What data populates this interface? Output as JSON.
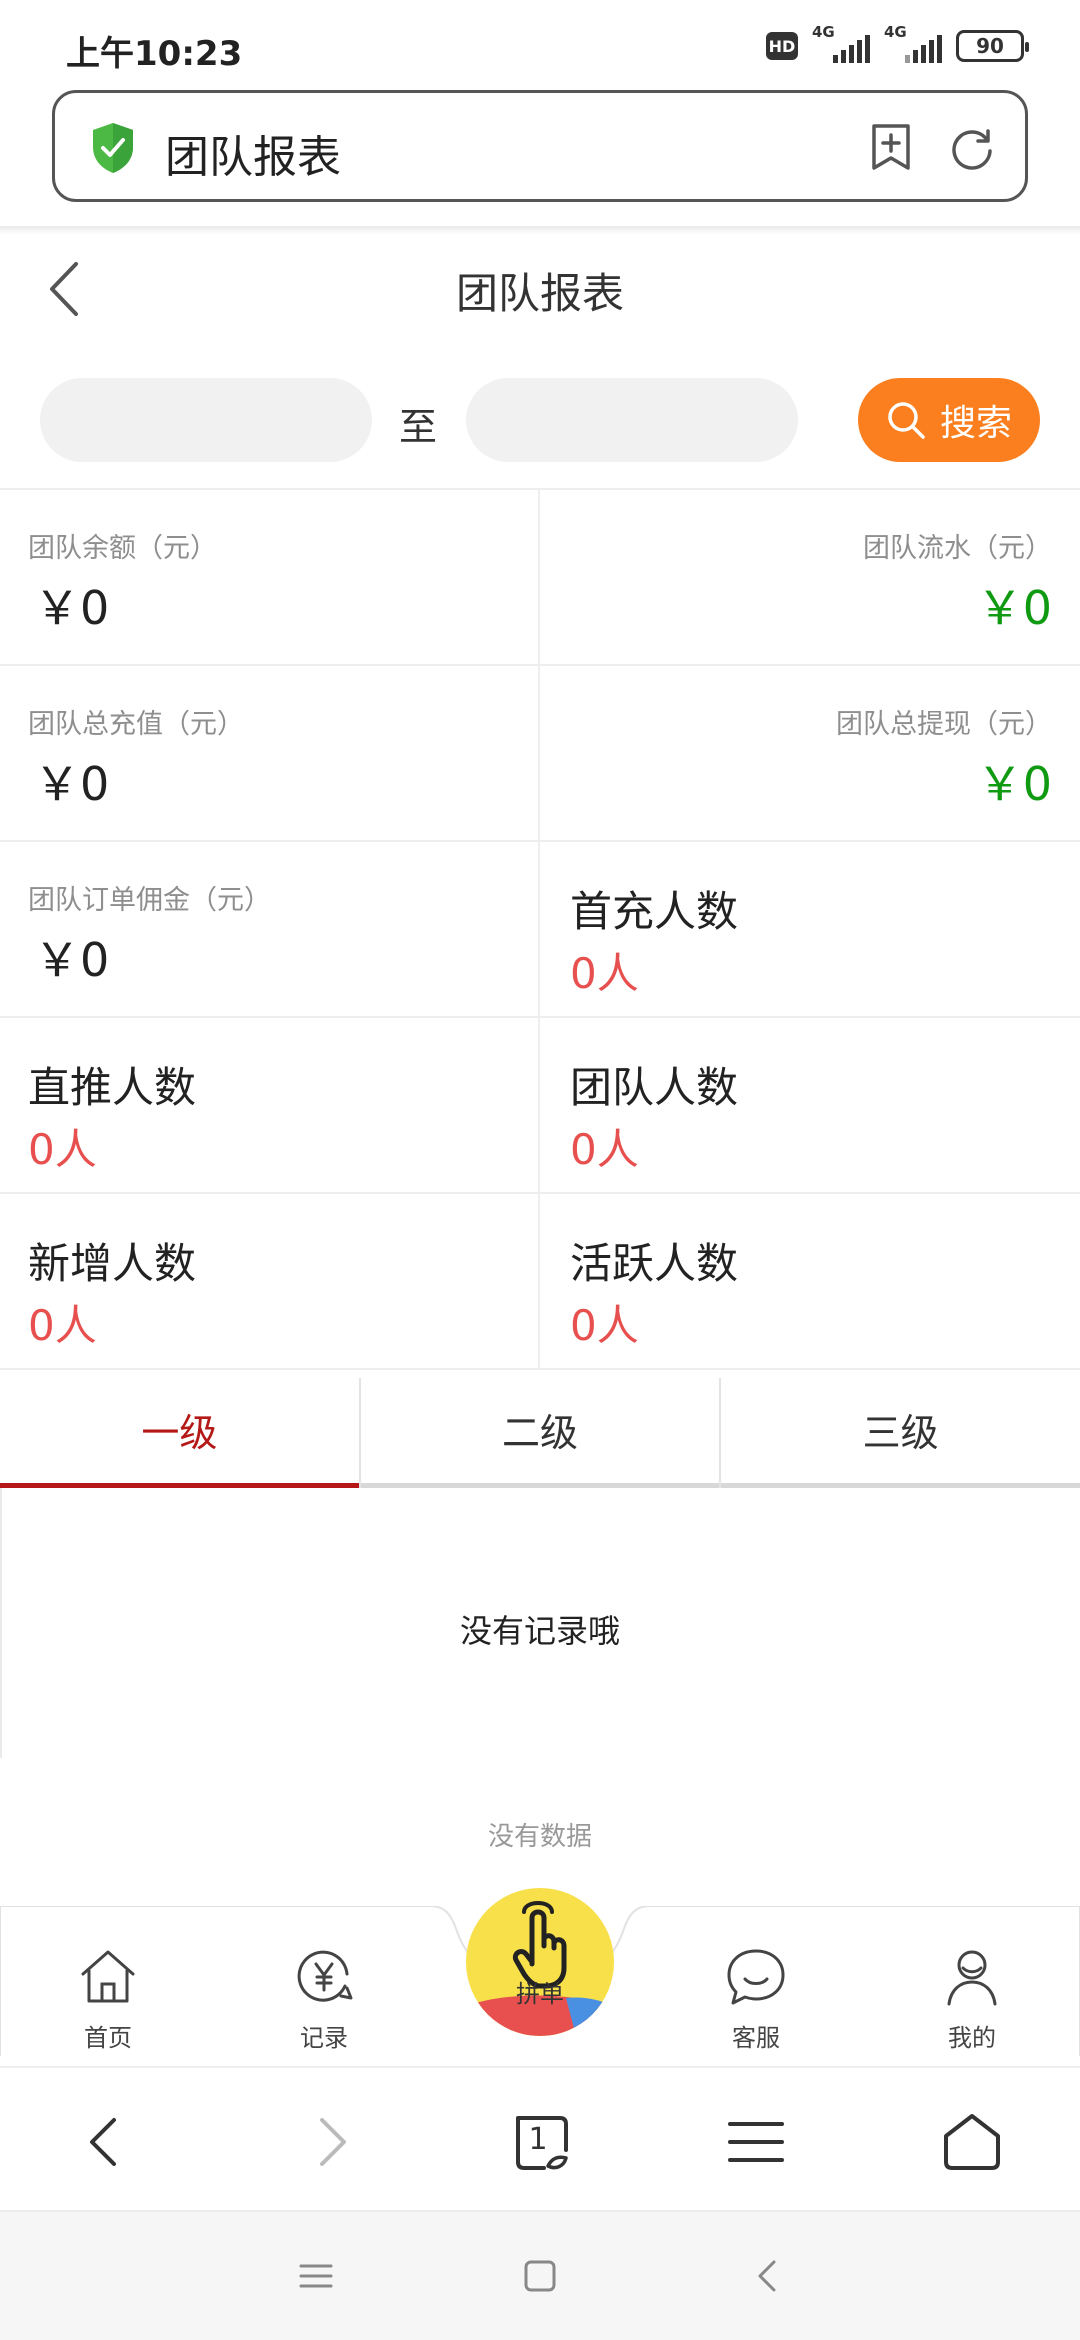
{
  "status_bar": {
    "time": "上午10:23",
    "hd_label": "HD",
    "network_1": "4G",
    "network_2": "4G",
    "battery": "90"
  },
  "address_bar": {
    "title": "团队报表",
    "icons": [
      "shield-check-icon",
      "bookmark-add-icon",
      "refresh-icon"
    ]
  },
  "header": {
    "title": "团队报表"
  },
  "search": {
    "start_date": "",
    "end_date": "",
    "separator": "至",
    "button_label": "搜索",
    "accent_color": "#fb7f1f"
  },
  "stats": {
    "balance": {
      "label": "团队余额（元）",
      "value": "￥0"
    },
    "turnover": {
      "label": "团队流水（元）",
      "value": "￥0"
    },
    "total_recharge": {
      "label": "团队总充值（元）",
      "value": "￥0"
    },
    "total_withdraw": {
      "label": "团队总提现（元）",
      "value": "￥0"
    },
    "order_commission": {
      "label": "团队订单佣金（元）",
      "value": "￥0"
    },
    "first_recharge": {
      "label": "首充人数",
      "value": "0人"
    },
    "direct_referrals": {
      "label": "直推人数",
      "value": "0人"
    },
    "team_members": {
      "label": "团队人数",
      "value": "0人"
    },
    "new_members": {
      "label": "新增人数",
      "value": "0人"
    },
    "active_members": {
      "label": "活跃人数",
      "value": "0人"
    },
    "colors": {
      "positive": "#0f9a12",
      "count": "#e8504f"
    }
  },
  "level_tabs": {
    "items": [
      {
        "label": "一级",
        "active": true
      },
      {
        "label": "二级",
        "active": false
      },
      {
        "label": "三级",
        "active": false
      }
    ],
    "active_color": "#b41817"
  },
  "list": {
    "empty_text": "没有记录哦",
    "no_data_text": "没有数据"
  },
  "bottom_nav": {
    "items": [
      {
        "label": "首页",
        "icon": "home-icon"
      },
      {
        "label": "记录",
        "icon": "yuan-record-icon"
      },
      {
        "label": "拼单",
        "icon": "tap-hand-icon"
      },
      {
        "label": "客服",
        "icon": "chat-bubble-icon"
      },
      {
        "label": "我的",
        "icon": "user-icon"
      }
    ]
  },
  "browser_toolbar": {
    "tab_count": "1",
    "icons": [
      "back-arrow-icon",
      "forward-arrow-icon",
      "tabs-icon",
      "menu-icon",
      "home-outline-icon"
    ]
  },
  "system_nav": {
    "icons": [
      "recents-icon",
      "home-square-icon",
      "back-triangle-icon"
    ]
  }
}
